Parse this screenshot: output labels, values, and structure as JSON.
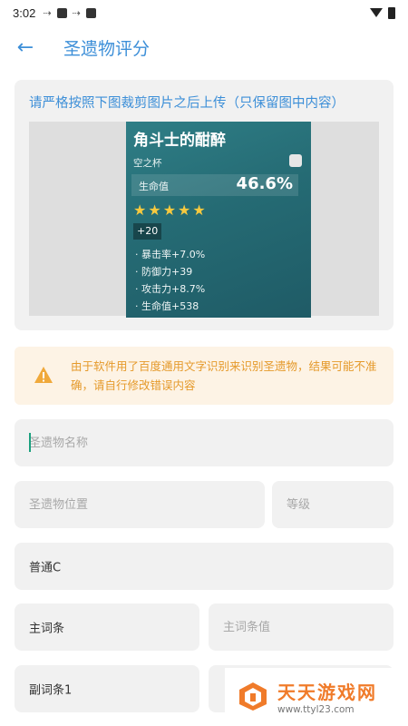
{
  "status_bar": {
    "time": "3:02"
  },
  "app_bar": {
    "title": "圣遗物评分"
  },
  "card": {
    "instruction": "请严格按照下图裁剪图片之后上传（只保留图中内容）"
  },
  "sample_artifact": {
    "name": "角斗士的酣醉",
    "type": "空之杯",
    "main_stat_label": "生命值",
    "main_stat_value": "46.6%",
    "stars": "★★★★★",
    "level": "+20",
    "substats": [
      "· 暴击率+7.0%",
      "· 防御力+39",
      "· 攻击力+8.7%",
      "· 生命值+538"
    ]
  },
  "warning": {
    "text": "由于软件用了百度通用文字识别来识别圣遗物，结果可能不准确，请自行修改错误内容"
  },
  "form": {
    "name_placeholder": "圣遗物名称",
    "position_placeholder": "圣遗物位置",
    "level_placeholder": "等级",
    "quality_value": "普通C",
    "main_stat_label": "主词条",
    "main_stat_value_placeholder": "主词条值",
    "sub_stat1_label": "副词条1"
  },
  "watermark": {
    "title": "天天游戏网",
    "url": "www.ttyl23.com"
  },
  "colors": {
    "accent": "#3d8fd8",
    "warning_text": "#e59a2b",
    "warning_bg": "#fdf3e5",
    "field_bg": "#f1f1f1"
  }
}
